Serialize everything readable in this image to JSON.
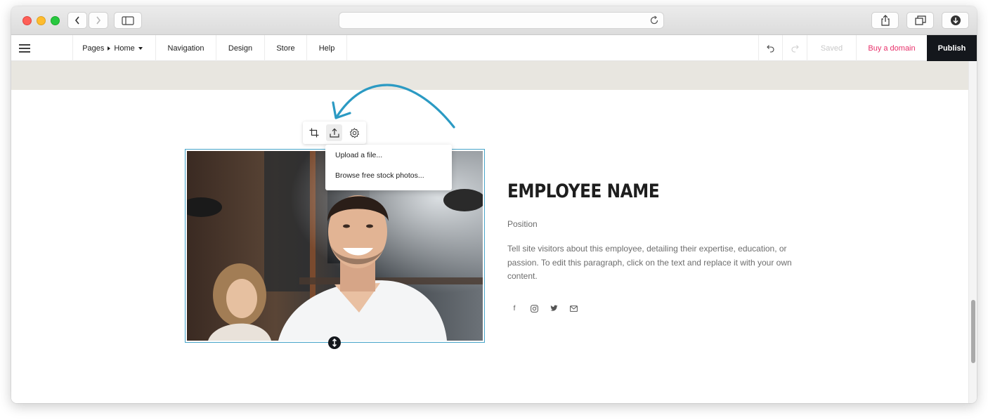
{
  "toolbar": {
    "pages_label": "Pages",
    "home_label": "Home",
    "navigation_label": "Navigation",
    "design_label": "Design",
    "store_label": "Store",
    "help_label": "Help",
    "saved_label": "Saved",
    "buy_domain_label": "Buy a domain",
    "publish_label": "Publish"
  },
  "image_menu": {
    "items": [
      "Upload a file...",
      "Browse free stock photos..."
    ]
  },
  "employee": {
    "name": "EMPLOYEE NAME",
    "position": "Position",
    "bio": "Tell site visitors about this employee, detailing their expertise, education, or passion. To edit this paragraph, click on the text and replace it with your own content."
  },
  "social": {
    "facebook_glyph": "f"
  },
  "colors": {
    "accent_blue": "#46a4c9",
    "arrow": "#2b9ac3",
    "buy_domain": "#e8306a",
    "publish_bg": "#14171c",
    "band": "#e8e6e0"
  },
  "icons": [
    "menu-icon",
    "undo-icon",
    "redo-icon",
    "crop-icon",
    "upload-icon",
    "gear-icon",
    "facebook-icon",
    "instagram-icon",
    "twitter-icon",
    "email-icon"
  ]
}
